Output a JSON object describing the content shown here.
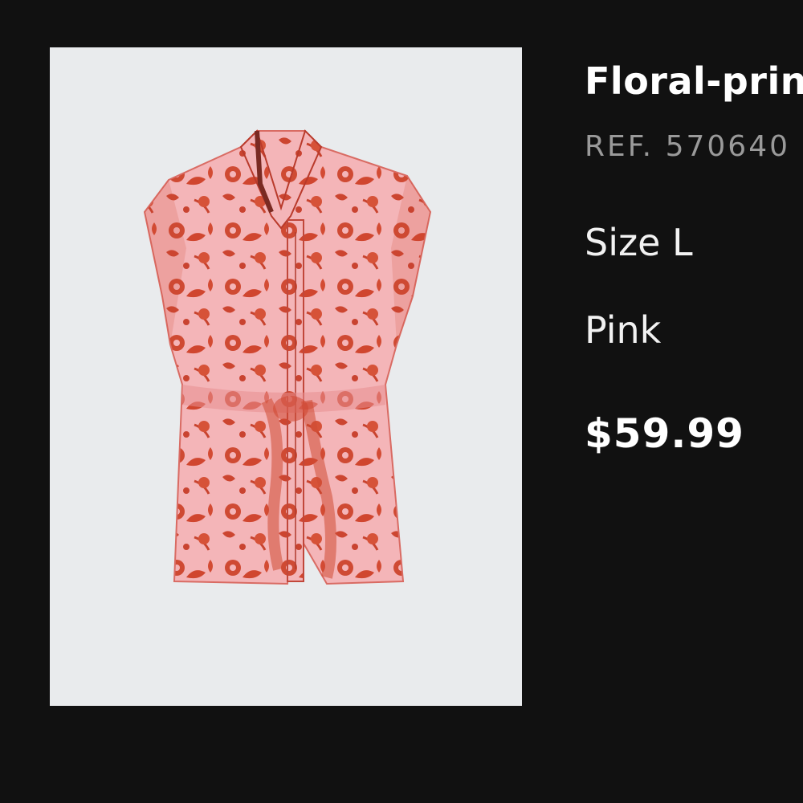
{
  "product": {
    "image_alt": "Floral-print shirt image",
    "title": "Floral-prin",
    "ref": "REF. 570640",
    "size": "Size L",
    "color": "Pink",
    "price": "$59.99"
  },
  "colors": {
    "background": "#111111",
    "image_background": "#e9ebed",
    "fabric_pink": "#f3b3b6",
    "print_red": "#d0462f",
    "text_primary": "#ffffff",
    "text_secondary": "#9a9a9a"
  }
}
